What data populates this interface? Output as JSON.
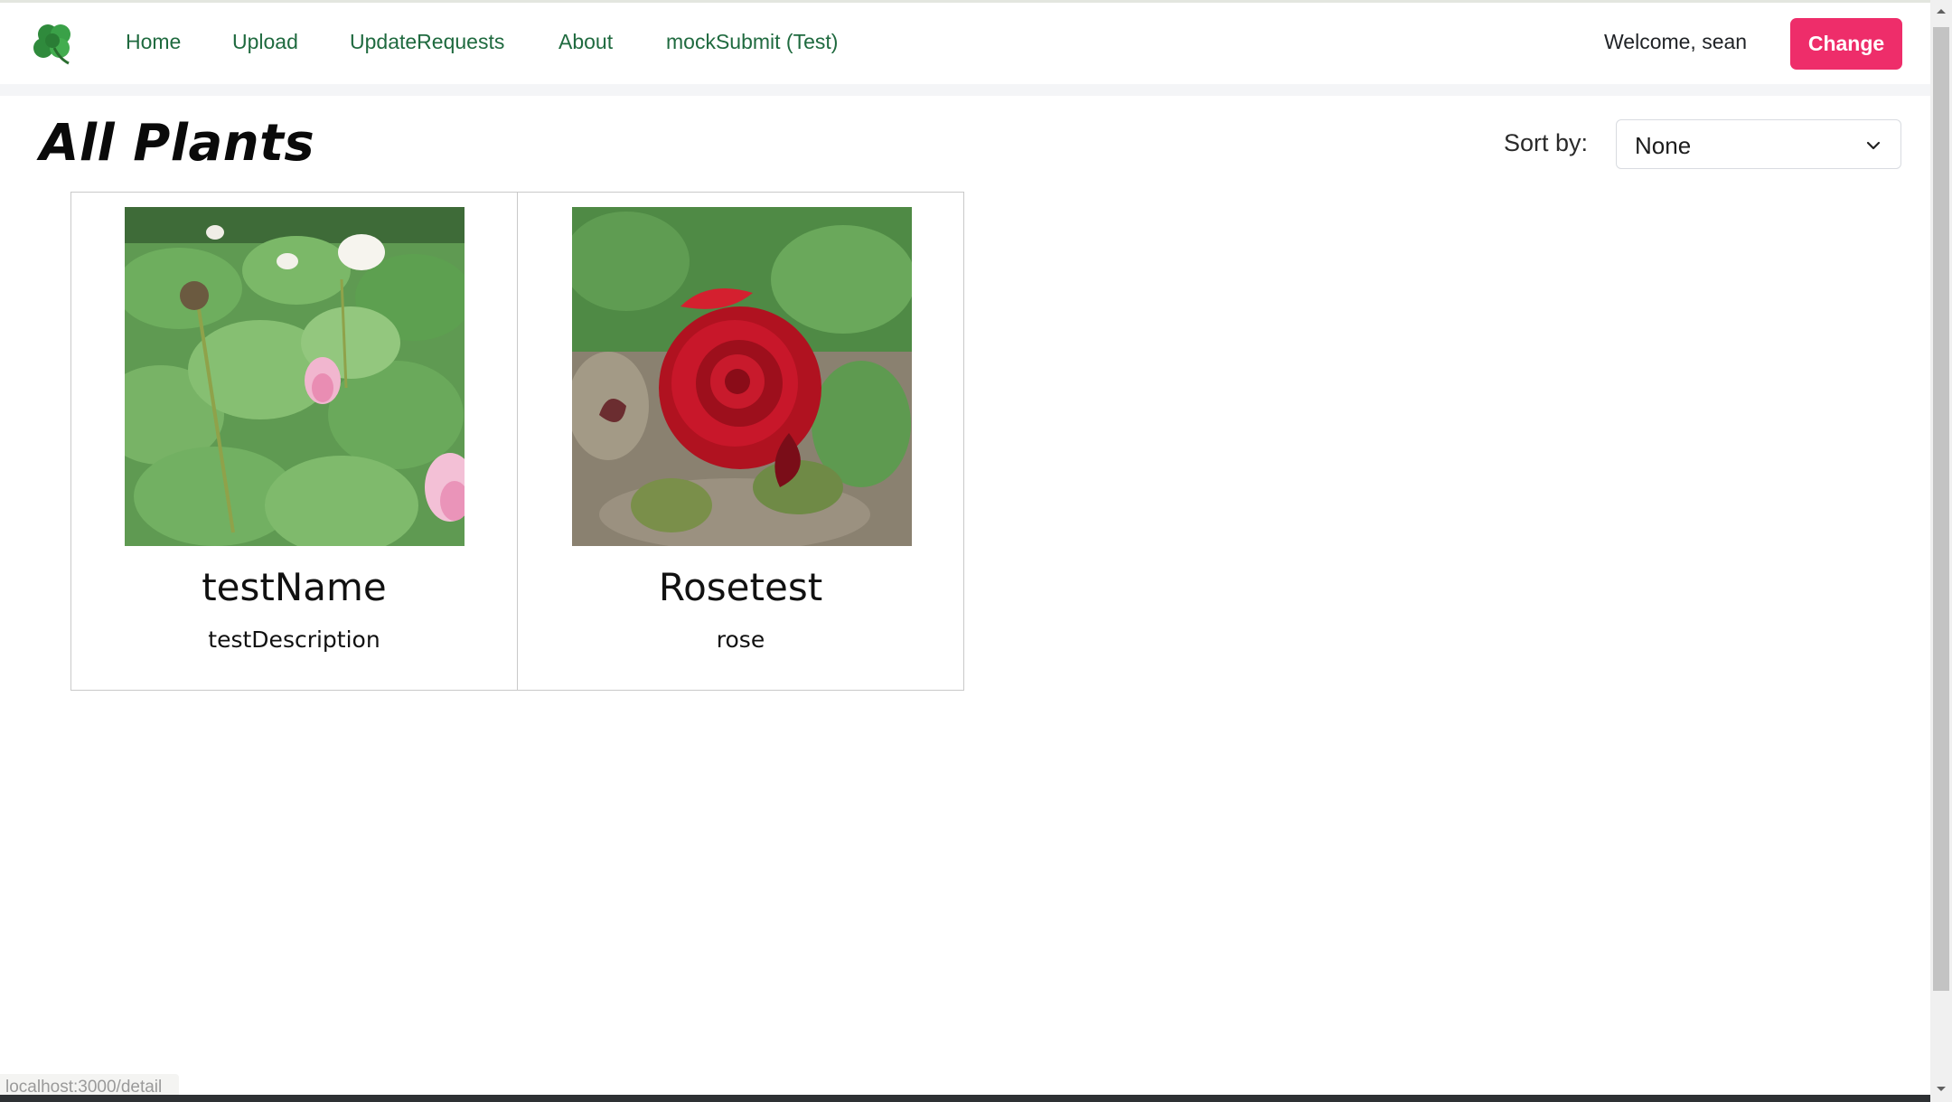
{
  "nav": {
    "links": [
      "Home",
      "Upload",
      "UpdateRequests",
      "About",
      "mockSubmit (Test)"
    ],
    "welcome": "Welcome, sean",
    "change_label": "Change",
    "logo_icon": "clover-icon"
  },
  "main": {
    "title": "All Plants",
    "sort_label": "Sort by:",
    "sort_value": "None"
  },
  "cards": [
    {
      "name": "testName",
      "description": "testDescription",
      "image": "lotus-pond-photo"
    },
    {
      "name": "Rosetest",
      "description": "rose",
      "image": "red-rose-photo"
    }
  ],
  "status_bar": {
    "url": "localhost:3000/detail"
  },
  "colors": {
    "nav_link": "#1f6a3f",
    "accent_button": "#ee2d6a"
  }
}
